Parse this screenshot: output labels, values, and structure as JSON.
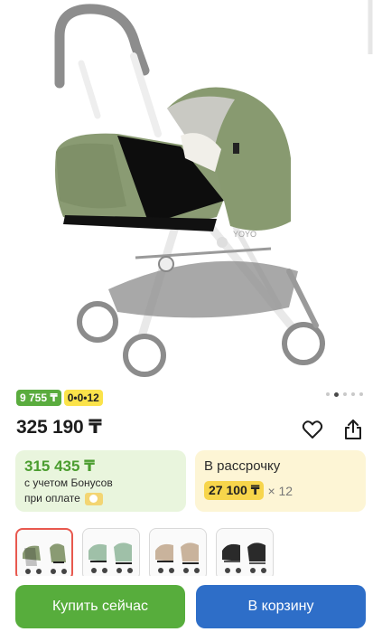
{
  "product": {
    "bonus_badge": "9 755 ₸",
    "installment_badge": "0•0•12",
    "price": "325 190 ₸",
    "image_label": "YOYO",
    "gallery": {
      "total": 5,
      "active": 2
    }
  },
  "bonus_card": {
    "amount": "315 435 ₸",
    "line1": "с учетом Бонусов",
    "line2": "при оплате"
  },
  "installment_card": {
    "title": "В рассрочку",
    "amount": "27 100 ₸",
    "months": "× 12"
  },
  "swatches": [
    {
      "name": "sage",
      "color": "#8a9b73",
      "selected": true
    },
    {
      "name": "mint",
      "color": "#9fc0a8",
      "selected": false
    },
    {
      "name": "beige",
      "color": "#c9b39c",
      "selected": false
    },
    {
      "name": "black",
      "color": "#2a2a2a",
      "selected": false
    }
  ],
  "actions": {
    "buy_now": "Купить сейчас",
    "add_to_cart": "В корзину"
  },
  "colors": {
    "green": "#57ad3c",
    "blue": "#2e6ec8",
    "yellow": "#f7d54b",
    "bonus_bg": "#e9f5dd",
    "install_bg": "#fdf5d5"
  }
}
